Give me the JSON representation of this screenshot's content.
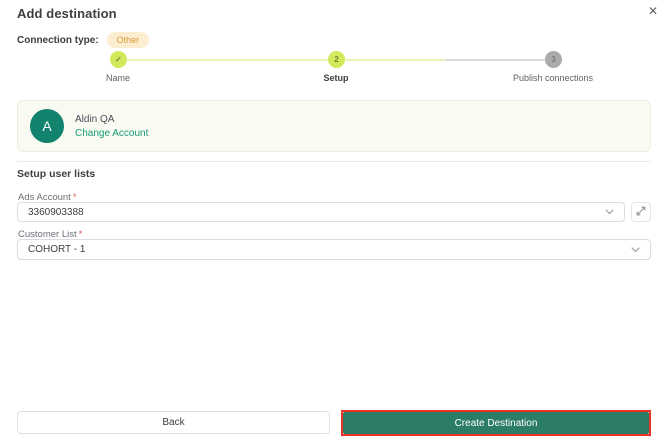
{
  "modal": {
    "title": "Add destination",
    "close_glyph": "✕"
  },
  "connection_type": {
    "label": "Connection type:",
    "badge": "Other"
  },
  "stepper": {
    "steps": [
      {
        "indicator": "✓",
        "label": "Name",
        "state": "complete"
      },
      {
        "indicator": "2",
        "label": "Setup",
        "state": "active"
      },
      {
        "indicator": "3",
        "label": "Publish connections",
        "state": "upcoming"
      }
    ]
  },
  "account_card": {
    "avatar_letter": "A",
    "name": "Aldin QA",
    "change_link": "Change Account"
  },
  "section": {
    "heading": "Setup user lists"
  },
  "fields": {
    "ads_account": {
      "label": "Ads Account",
      "required_mark": "*",
      "value": "3360903388"
    },
    "customer_list": {
      "label": "Customer List",
      "required_mark": "*",
      "value": "COHORT - 1"
    }
  },
  "footer": {
    "back_label": "Back",
    "create_label": "Create Destination"
  },
  "colors": {
    "accent_lime": "#d3e95c",
    "accent_teal": "#12836c",
    "link_teal": "#169a78",
    "badge_bg": "#fcedd0",
    "badge_text": "#d79a3d",
    "annotation_red": "#ee3124"
  }
}
